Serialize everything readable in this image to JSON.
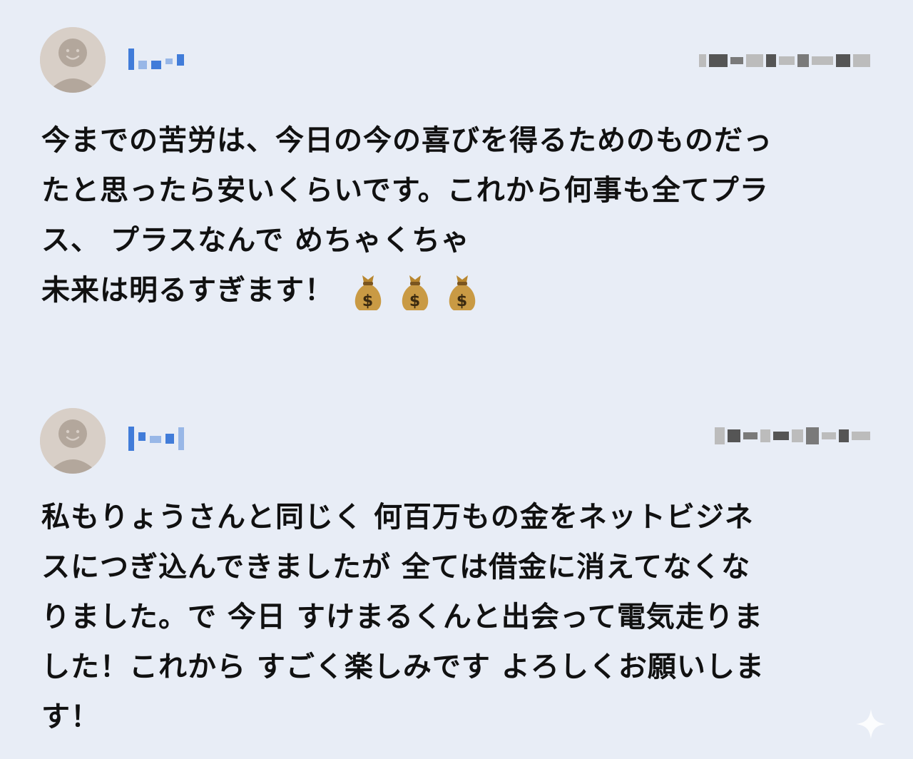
{
  "posts": [
    {
      "avatar_icon": "default-avatar-icon",
      "username_blurred": true,
      "timestamp_blurred": true,
      "comment_lines": [
        "今までの苦労は、今日の今の喜びを得るためのものだっ",
        "たと思ったら安いくらいです。これから何事も全てプラ",
        "ス、 プラスなんで めちゃくちゃ",
        "未来は明るすぎます！"
      ],
      "emoji": [
        "money-bag-icon",
        "money-bag-icon",
        "money-bag-icon"
      ]
    },
    {
      "avatar_icon": "default-avatar-icon",
      "username_blurred": true,
      "timestamp_blurred": true,
      "comment_lines": [
        "私もりょうさんと同じく 何百万もの金をネットビジネ",
        "スにつぎ込んできましたが 全ては借金に消えてなくな",
        "りました。で 今日 すけまるくんと出会って電気走りま",
        "した！これから すごく楽しみです よろしくお願いしま",
        "す！"
      ]
    }
  ],
  "colors": {
    "background": "#e8edf6",
    "avatar_bg": "#d8cfc7",
    "avatar_face": "#b3a79c",
    "username_blur": "#2f6fd6",
    "text": "#111111"
  },
  "decor": {
    "corner_icon": "sparkle-icon"
  }
}
